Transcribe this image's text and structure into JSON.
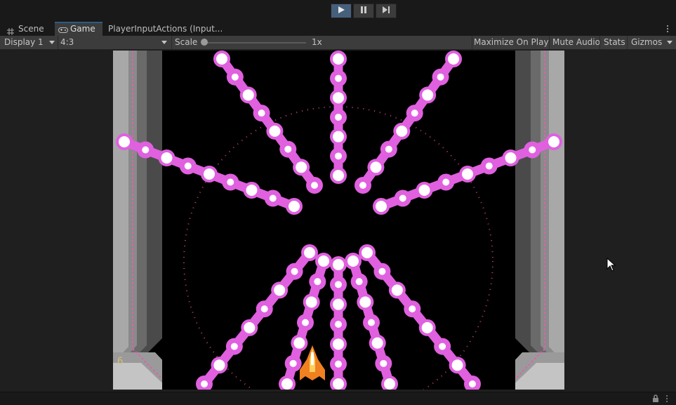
{
  "playbar": {
    "play_icon": "play-icon",
    "pause_icon": "pause-icon",
    "step_icon": "step-icon",
    "accent": "#46607c"
  },
  "tabs": [
    {
      "label": "Scene",
      "icon": "scene-grid-icon"
    },
    {
      "label": "Game",
      "icon": "gamepad-icon"
    },
    {
      "label": "PlayerInputActions (Input..."
    }
  ],
  "toolbar": {
    "display": "Display 1",
    "aspect": "4:3",
    "scale_label": "Scale",
    "scale_value": "1x",
    "scale_fraction": 0.0,
    "maximize": "Maximize On Play",
    "mute": "Mute Audio",
    "stats": "Stats",
    "gizmos": "Gizmos"
  },
  "game": {
    "score": "6",
    "bullet_color": "#e060e0",
    "bullet_core": "#ffffff",
    "ship_color": "#f08020",
    "background": "#000000"
  },
  "colors": {
    "editor_bg": "#191919",
    "panel": "#3c3c3c",
    "tab_accent": "#2c5d87"
  }
}
